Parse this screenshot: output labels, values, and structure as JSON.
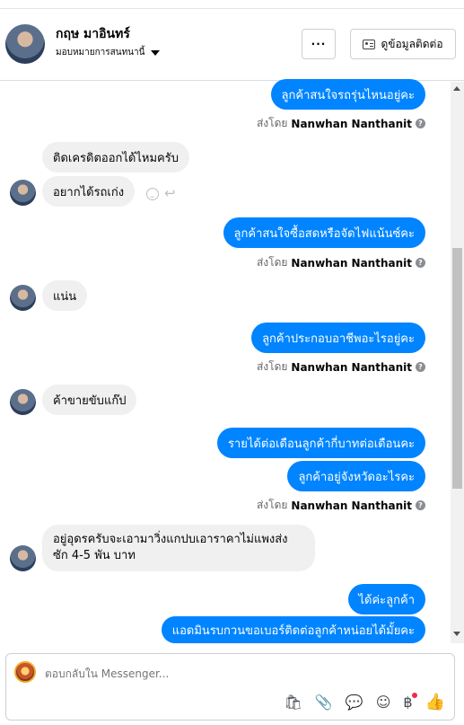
{
  "header": {
    "name": "กฤษ มาอินทร์",
    "assign_label": "มอบหมายการสนทนานี้",
    "more_label": "···",
    "contact_button_label": "ดูข้อมูลติดต่อ"
  },
  "messages": {
    "m1": "ลูกค้าสนใจรถรุ่นไหนอยู่คะ",
    "sent_by_prefix": "ส่งโดย",
    "sender_name": "Nanwhan Nanthanit",
    "m2": "ติดเครดิตออกได้ไหมครับ",
    "m3": "อยากได้รถเก่ง",
    "m4": "ลูกค้าสนใจซื้อสดหรือจัดไฟแน้นซ์คะ",
    "m5": "แน่น",
    "m6": "ลูกค้าประกอบอาชีพอะไรอยู่คะ",
    "m7": "ค้าขายขับแก๊ป",
    "m8": "รายได้ต่อเดือนลูกค้ากี่บาทต่อเดือนคะ",
    "m9": "ลูกค้าอยู่จังหวัดอะไรคะ",
    "m10_line1": "อยู่อุดรครับจะเอามาวิ่งแกปบเอาราคาไม่แพงส่ง",
    "m10_line2": "ซัก 4-5 พัน บาท",
    "m11": "ได้ค่ะลูกค้า",
    "m12": "แอดมินรบกวนขอเบอร์ติดต่อลูกค้าหน่อยได้มั้ยคะ"
  },
  "composer": {
    "placeholder": "ตอบกลับใน Messenger..."
  },
  "colors": {
    "outgoing": "#0084ff",
    "incoming": "#f0f0f0"
  }
}
